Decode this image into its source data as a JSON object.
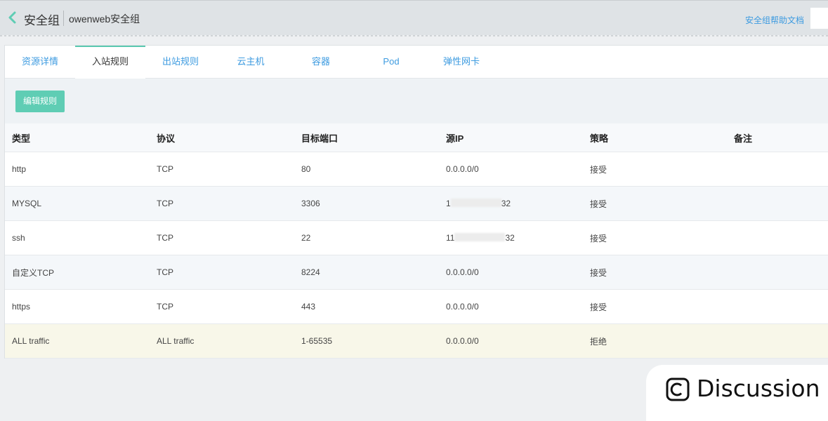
{
  "header": {
    "title": "安全组",
    "group_name": "owenweb安全组",
    "help_link": "安全组帮助文档"
  },
  "tabs": [
    {
      "label": "资源详情"
    },
    {
      "label": "入站规则",
      "active": true
    },
    {
      "label": "出站规则"
    },
    {
      "label": "云主机"
    },
    {
      "label": "容器"
    },
    {
      "label": "Pod"
    },
    {
      "label": "弹性网卡"
    }
  ],
  "toolbar": {
    "edit_label": "编辑规则"
  },
  "table": {
    "columns": [
      "类型",
      "协议",
      "目标端口",
      "源IP",
      "策略",
      "备注"
    ],
    "rows": [
      {
        "type": "http",
        "protocol": "TCP",
        "port": "80",
        "source_prefix": "0.0.0.0/0",
        "source_suffix": "",
        "masked": false,
        "policy": "接受",
        "note": ""
      },
      {
        "type": "MYSQL",
        "protocol": "TCP",
        "port": "3306",
        "source_prefix": "1",
        "source_suffix": "32",
        "masked": true,
        "policy": "接受",
        "note": ""
      },
      {
        "type": "ssh",
        "protocol": "TCP",
        "port": "22",
        "source_prefix": "11",
        "source_suffix": "32",
        "masked": true,
        "policy": "接受",
        "note": ""
      },
      {
        "type": "自定义TCP",
        "protocol": "TCP",
        "port": "8224",
        "source_prefix": "0.0.0.0/0",
        "source_suffix": "",
        "masked": false,
        "policy": "接受",
        "note": ""
      },
      {
        "type": "https",
        "protocol": "TCP",
        "port": "443",
        "source_prefix": "0.0.0.0/0",
        "source_suffix": "",
        "masked": false,
        "policy": "接受",
        "note": ""
      },
      {
        "type": "ALL traffic",
        "protocol": "ALL traffic",
        "port": "1-65535",
        "source_prefix": "0.0.0.0/0",
        "source_suffix": "",
        "masked": false,
        "policy": "拒绝",
        "note": ""
      }
    ]
  },
  "badge": {
    "label": "Discussion"
  },
  "colors": {
    "accent": "#5fcdb4",
    "link": "#3d9be0",
    "deny_row": "#f8f7e9"
  }
}
